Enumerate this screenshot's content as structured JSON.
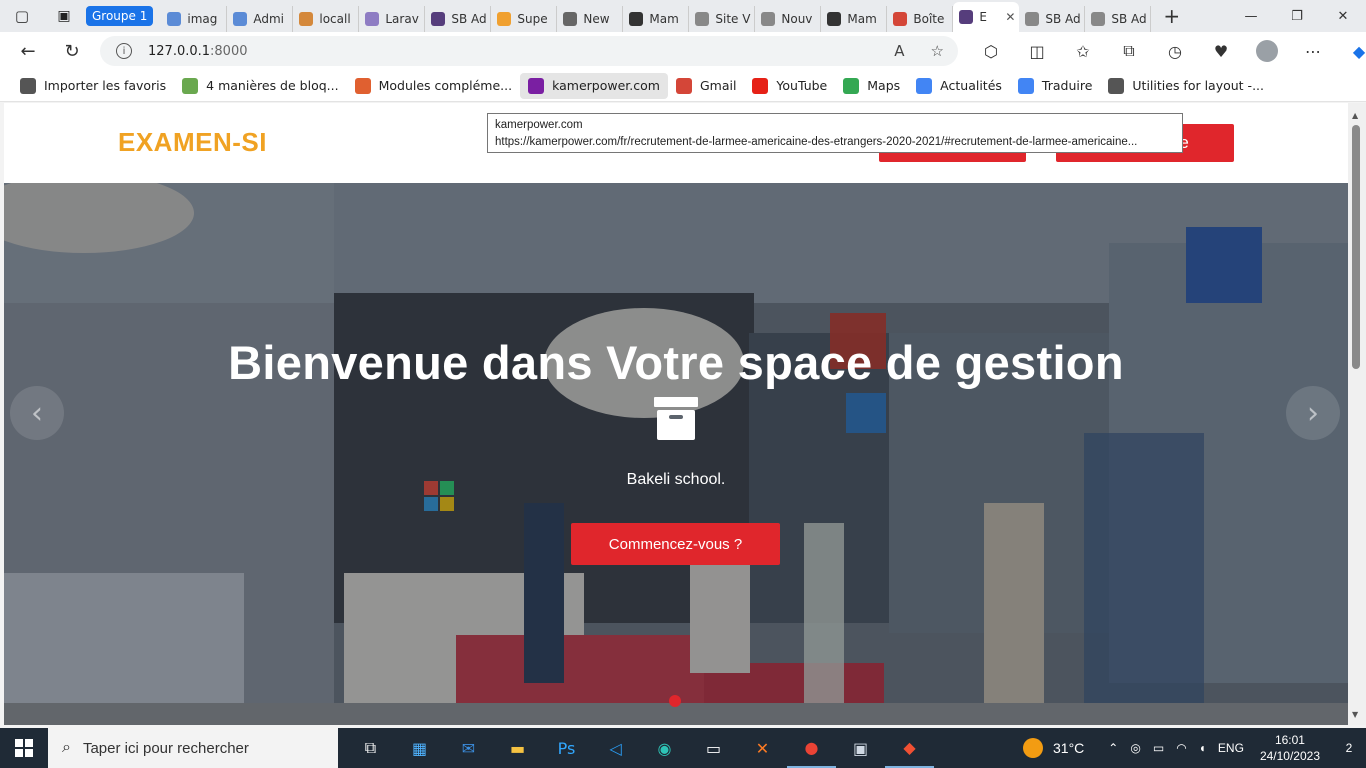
{
  "browser": {
    "tab_group": "Groupe 1",
    "tabs": [
      {
        "label": "imag",
        "color": "#5b8bd6"
      },
      {
        "label": "Admi",
        "color": "#5b8bd6"
      },
      {
        "label": "locall",
        "color": "#d4883b"
      },
      {
        "label": "Larav",
        "color": "#8e7cc3"
      },
      {
        "label": "SB Ad",
        "color": "#563d7c"
      },
      {
        "label": "Supe",
        "color": "#f0a030"
      },
      {
        "label": "New",
        "color": "#666666"
      },
      {
        "label": "Mam",
        "color": "#333333"
      },
      {
        "label": "Site V",
        "color": "#888888"
      },
      {
        "label": "Nouv",
        "color": "#888888"
      },
      {
        "label": "Mam",
        "color": "#333333"
      },
      {
        "label": "Boîte",
        "color": "#d44638"
      },
      {
        "label": "E",
        "color": "#563d7c",
        "active": true
      },
      {
        "label": "SB Ad",
        "color": "#888888"
      },
      {
        "label": "SB Ad",
        "color": "#888888"
      }
    ],
    "url_host": "127.0.0.1",
    "url_port": ":8000",
    "bookmarks": [
      {
        "label": "Importer les favoris",
        "color": "#555555"
      },
      {
        "label": "4 manières de bloq...",
        "color": "#6aa84f"
      },
      {
        "label": "Modules compléme...",
        "color": "#e06030"
      },
      {
        "label": "kamerpower.com",
        "color": "#7a1fa2",
        "highlight": true
      },
      {
        "label": "Gmail",
        "color": "#d44638"
      },
      {
        "label": "YouTube",
        "color": "#e62117"
      },
      {
        "label": "Maps",
        "color": "#34a853"
      },
      {
        "label": "Actualités",
        "color": "#4285f4"
      },
      {
        "label": "Traduire",
        "color": "#4285f4"
      },
      {
        "label": "Utilities for layout -...",
        "color": "#555555"
      }
    ],
    "tooltip": {
      "title": "kamerpower.com",
      "url": "https://kamerpower.com/fr/recrutement-de-larmee-americaine-des-etrangers-2020-2021/#recrutement-de-larmee-americaine..."
    }
  },
  "site": {
    "logo": "EXAMEN-SI",
    "header_buttons": {
      "login": "",
      "register": "pte"
    },
    "hero": {
      "title": "Bienvenue dans Votre space de gestion",
      "subtitle": "Bakeli school.",
      "cta": "Commencez-vous ?",
      "prev": "‹",
      "next": "›"
    }
  },
  "taskbar": {
    "search_placeholder": "Taper ici pour rechercher",
    "weather": "31°C",
    "language": "ENG",
    "time": "16:01",
    "date": "24/10/2023",
    "notifications": "2"
  },
  "colors": {
    "accent_red": "#e0262c",
    "logo_orange": "#f0a223"
  }
}
